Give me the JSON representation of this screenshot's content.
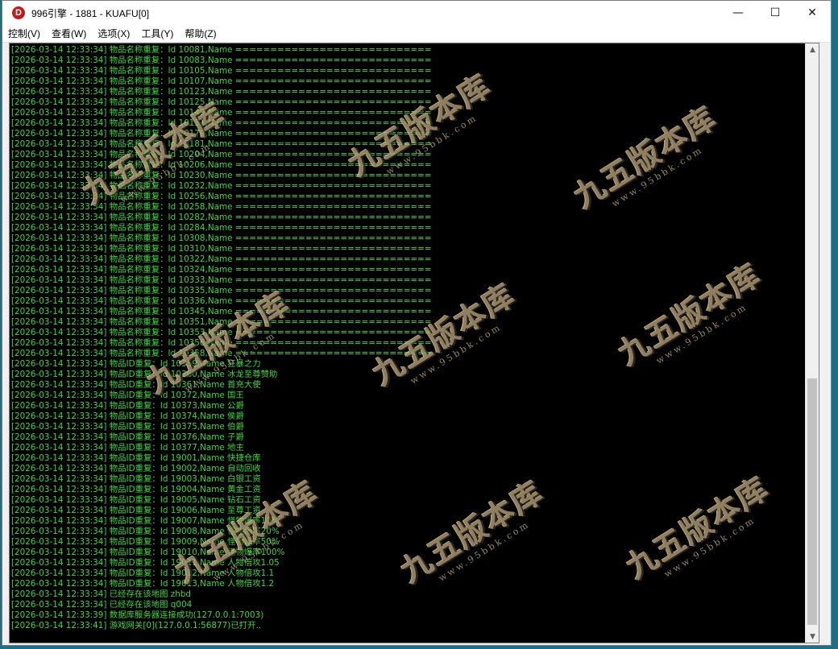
{
  "window": {
    "title": "996引擎 - 1881 - KUAFU[0]",
    "app_icon_glyph": "D",
    "minimize_glyph": "—",
    "maximize_glyph": "☐",
    "close_glyph": "✕"
  },
  "menu": [
    "控制(V)",
    "查看(W)",
    "选项(X)",
    "工具(Y)",
    "帮助(Z)"
  ],
  "scrollbar": {
    "up_glyph": "▲",
    "down_glyph": "▼",
    "position": 0.93
  },
  "watermark": {
    "main": "九五版本库",
    "sub": "www.95bbk.com"
  },
  "log": [
    "[2026-03-14 12:33:34] 物品名称重复：Id 10081,Name ============================",
    "[2026-03-14 12:33:34] 物品名称重复：Id 10083,Name ============================",
    "[2026-03-14 12:33:34] 物品名称重复：Id 10105,Name ============================",
    "[2026-03-14 12:33:34] 物品名称重复：Id 10107,Name ============================",
    "[2026-03-14 12:33:34] 物品名称重复：Id 10123,Name ============================",
    "[2026-03-14 12:33:34] 物品名称重复：Id 10125,Name ============================",
    "[2026-03-14 12:33:34] 物品名称重复：Id 10149,Name ============================",
    "[2026-03-14 12:33:34] 物品名称重复：Id 10151,Name ============================",
    "[2026-03-14 12:33:34] 物品名称重复：Id 10179,Name ============================",
    "[2026-03-14 12:33:34] 物品名称重复：Id 10181,Name ============================",
    "[2026-03-14 12:33:34] 物品名称重复：Id 10204,Name ============================",
    "[2026-03-14 12:33:34] 物品名称重复：Id 10206,Name ============================",
    "[2026-03-14 12:33:34] 物品名称重复：Id 10230,Name ============================",
    "[2026-03-14 12:33:34] 物品名称重复：Id 10232,Name ============================",
    "[2026-03-14 12:33:34] 物品名称重复：Id 10256,Name ============================",
    "[2026-03-14 12:33:34] 物品名称重复：Id 10258,Name ============================",
    "[2026-03-14 12:33:34] 物品名称重复：Id 10282,Name ============================",
    "[2026-03-14 12:33:34] 物品名称重复：Id 10284,Name ============================",
    "[2026-03-14 12:33:34] 物品名称重复：Id 10308,Name ============================",
    "[2026-03-14 12:33:34] 物品名称重复：Id 10310,Name ============================",
    "[2026-03-14 12:33:34] 物品名称重复：Id 10322,Name ============================",
    "[2026-03-14 12:33:34] 物品名称重复：Id 10324,Name ============================",
    "[2026-03-14 12:33:34] 物品名称重复：Id 10333,Name ============================",
    "[2026-03-14 12:33:34] 物品名称重复：Id 10335,Name ============================",
    "[2026-03-14 12:33:34] 物品名称重复：Id 10336,Name ============================",
    "[2026-03-14 12:33:34] 物品名称重复：Id 10345,Name ============================",
    "[2026-03-14 12:33:34] 物品名称重复：Id 10351,Name ============================",
    "[2026-03-14 12:33:34] 物品名称重复：Id 10353,Name ============================",
    "[2026-03-14 12:33:34] 物品名称重复：Id 10356,Name ============================",
    "[2026-03-14 12:33:34] 物品名称重复：Id 10358,Name ============================",
    "[2026-03-14 12:33:34] 物品ID重复：Id 10359,Name 狂暴之力",
    "[2026-03-14 12:33:34] 物品ID重复：Id 10360,Name 冰龙至尊赞助",
    "[2026-03-14 12:33:34] 物品ID重复：Id 10361,Name 首充大使",
    "[2026-03-14 12:33:34] 物品ID重复：Id 10372,Name 国王",
    "[2026-03-14 12:33:34] 物品ID重复：Id 10373,Name 公爵",
    "[2026-03-14 12:33:34] 物品ID重复：Id 10374,Name 侯爵",
    "[2026-03-14 12:33:34] 物品ID重复：Id 10375,Name 伯爵",
    "[2026-03-14 12:33:34] 物品ID重复：Id 10376,Name 子爵",
    "[2026-03-14 12:33:34] 物品ID重复：Id 10377,Name 地主",
    "[2026-03-14 12:33:34] 物品ID重复：Id 19001,Name 快捷仓库",
    "[2026-03-14 12:33:34] 物品ID重复：Id 19002,Name 自动回收",
    "[2026-03-14 12:33:34] 物品ID重复：Id 19003,Name 白银工资",
    "[2026-03-14 12:33:34] 物品ID重复：Id 19004,Name 黄金工资",
    "[2026-03-14 12:33:34] 物品ID重复：Id 19005,Name 钻石工资",
    "[2026-03-14 12:33:34] 物品ID重复：Id 19006,Name 至尊工资",
    "[2026-03-14 12:33:34] 物品ID重复：Id 19007,Name 怪物爆率10%",
    "[2026-03-14 12:33:34] 物品ID重复：Id 19008,Name 怪物爆率20%",
    "[2026-03-14 12:33:34] 物品ID重复：Id 19009,Name 怪物爆率50%",
    "[2026-03-14 12:33:34] 物品ID重复：Id 19010,Name 怪物爆率100%",
    "[2026-03-14 12:33:34] 物品ID重复：Id 19011,Name 人物倍攻1.05",
    "[2026-03-14 12:33:34] 物品ID重复：Id 19012,Name 人物倍攻1.1",
    "[2026-03-14 12:33:34] 物品ID重复：Id 19013,Name 人物倍攻1.2",
    "[2026-03-14 12:33:34] 已经存在该地图 zhbd",
    "[2026-03-14 12:33:34] 已经存在该地图 q004",
    "[2026-03-14 12:33:39] 数据库服务器连接成功(127.0.0.1:7003)",
    "[2026-03-14 12:33:41] 游戏网关[0](127.0.0.1:56877)已打开.."
  ]
}
